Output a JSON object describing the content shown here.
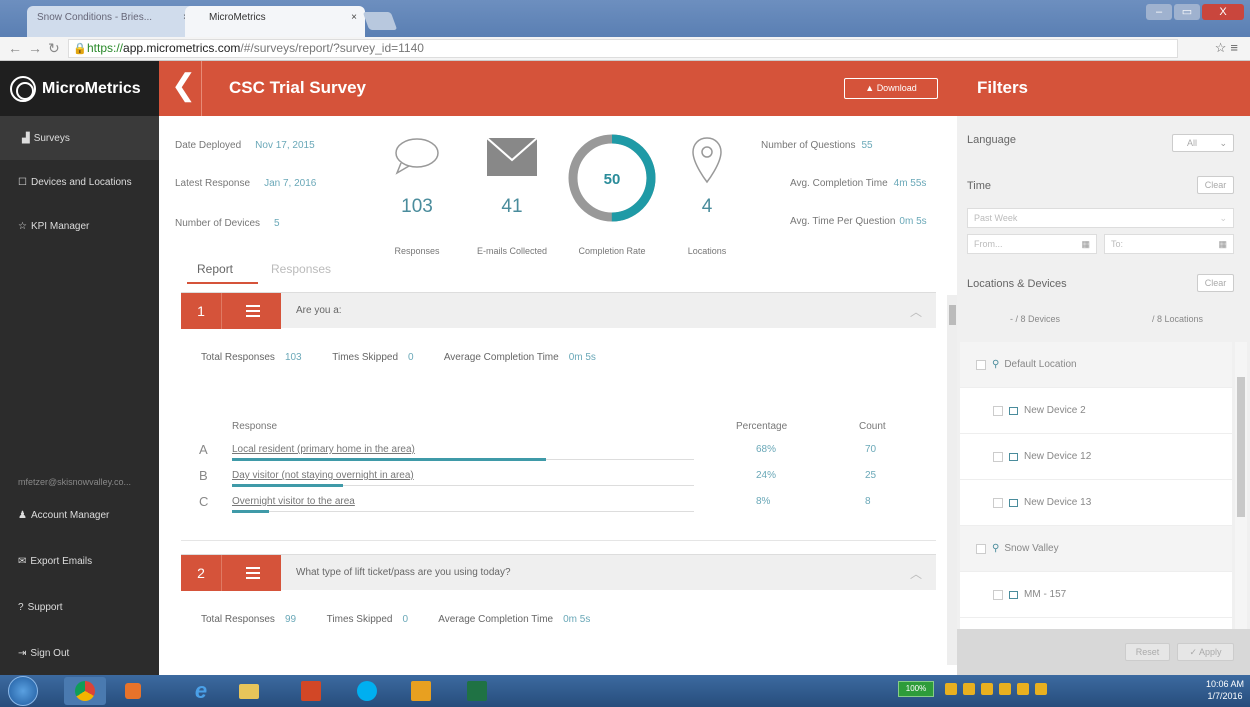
{
  "browser": {
    "tabs": [
      {
        "label": "Snow Conditions - Bries...",
        "close": "×"
      },
      {
        "label": "MicroMetrics",
        "close": "×"
      }
    ],
    "url_scheme": "https://",
    "url_host": "app.micrometrics.com",
    "url_path": "/#/surveys/report/?survey_id=1140",
    "window_controls": [
      "–",
      "▭",
      "X"
    ]
  },
  "sidebar": {
    "logo": "MicroMetrics",
    "items": [
      {
        "label": "Surveys",
        "icon": "bar-chart-icon"
      },
      {
        "label": "Devices and Locations",
        "icon": "square-icon"
      },
      {
        "label": "KPI Manager",
        "icon": "star-icon"
      }
    ],
    "email": "mfetzer@skisnowvalley.co...",
    "bottom_items": [
      {
        "label": "Account Manager",
        "icon": "user-icon"
      },
      {
        "label": "Export Emails",
        "icon": "mail-icon"
      },
      {
        "label": "Support",
        "icon": "question-icon"
      },
      {
        "label": "Sign Out",
        "icon": "sign-out-icon"
      }
    ]
  },
  "header": {
    "title": "CSC Trial Survey",
    "download_label": "Download"
  },
  "summary": {
    "left": [
      {
        "label": "Date Deployed",
        "value": "Nov 17, 2015"
      },
      {
        "label": "Latest Response",
        "value": "Jan 7, 2016"
      },
      {
        "label": "Number of Devices",
        "value": "5"
      }
    ],
    "stats": [
      {
        "value": "103",
        "label": "Responses"
      },
      {
        "value": "41",
        "label": "E-mails Collected"
      },
      {
        "value": "50",
        "label": "Completion Rate"
      },
      {
        "value": "4",
        "label": "Locations"
      }
    ],
    "completion_rate": 50,
    "right": [
      {
        "label": "Number of Questions",
        "value": "55"
      },
      {
        "label": "Avg. Completion Time",
        "value": "4m 55s"
      },
      {
        "label": "Avg. Time Per Question",
        "value": "0m 5s"
      }
    ]
  },
  "tabs": {
    "report": "Report",
    "responses": "Responses"
  },
  "labels": {
    "total_responses": "Total Responses",
    "times_skipped": "Times Skipped",
    "avg_completion": "Average Completion Time",
    "response_col": "Response",
    "percentage_col": "Percentage",
    "count_col": "Count"
  },
  "questions": [
    {
      "number": "1",
      "text": "Are you a:",
      "total_responses": "103",
      "times_skipped": "0",
      "avg_time": "0m 5s",
      "responses": [
        {
          "letter": "A",
          "text": "Local resident (primary home in the area)",
          "percent": "68%",
          "fraction": 0.68,
          "count": "70"
        },
        {
          "letter": "B",
          "text": "Day visitor (not staying overnight in area)",
          "percent": "24%",
          "fraction": 0.24,
          "count": "25"
        },
        {
          "letter": "C",
          "text": "Overnight visitor to the area",
          "percent": "8%",
          "fraction": 0.08,
          "count": "8"
        }
      ]
    },
    {
      "number": "2",
      "text": "What type of lift ticket/pass are you using today?",
      "total_responses": "99",
      "times_skipped": "0",
      "avg_time": "0m 5s"
    }
  ],
  "filters": {
    "title": "Filters",
    "language_label": "Language",
    "language_value": "All",
    "time_label": "Time",
    "clear": "Clear",
    "time_range": "Past Week",
    "from_placeholder": "From...",
    "to_placeholder": "To:",
    "locations_label": "Locations & Devices",
    "devices_count": "- / 8 Devices",
    "locations_count": "/ 8 Locations",
    "tree": [
      {
        "type": "location",
        "label": "Default Location"
      },
      {
        "type": "device",
        "label": "New Device 2"
      },
      {
        "type": "device",
        "label": "New Device 12"
      },
      {
        "type": "device",
        "label": "New Device 13"
      },
      {
        "type": "location",
        "label": "Snow Valley"
      },
      {
        "type": "device",
        "label": "MM - 157"
      }
    ],
    "reset": "Reset",
    "apply": "Apply"
  },
  "taskbar": {
    "battery": "100%",
    "time": "10:06 AM",
    "date": "1/7/2016"
  },
  "colors": {
    "accent": "#d5533a",
    "teal": "#3f9aa8",
    "sidebar": "#2c2c2c"
  }
}
